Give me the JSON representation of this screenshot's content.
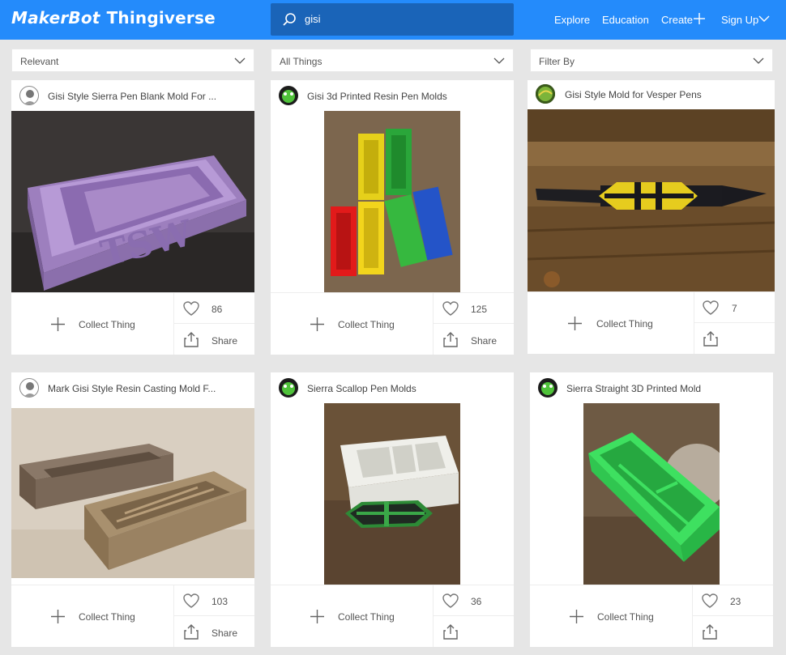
{
  "header": {
    "logo_maker": "MakerBot",
    "logo_product": "Thingiverse",
    "search_value": "gisi",
    "nav": {
      "explore": "Explore",
      "education": "Education",
      "create": "Create",
      "signup": "Sign Up"
    },
    "colors": {
      "bar": "#248bfb",
      "search_bg": "#1a64b8"
    }
  },
  "filters": {
    "sort": "Relevant",
    "category": "All Things",
    "filter_by": "Filter By"
  },
  "cards": [
    {
      "title": "Gisi Style Sierra Pen Blank Mold For ...",
      "likes": "86",
      "collect": "Collect Thing",
      "share": "Share",
      "avatar": "person-avatar-icon"
    },
    {
      "title": "Gisi 3d Printed Resin Pen Molds",
      "likes": "125",
      "collect": "Collect Thing",
      "share": "Share",
      "avatar": "frog-avatar-icon"
    },
    {
      "title": "Gisi Style Mold for Vesper Pens",
      "likes": "7",
      "collect": "Collect Thing",
      "share": "",
      "avatar": "green-avatar-icon"
    },
    {
      "title": "Mark Gisi Style Resin Casting Mold F...",
      "likes": "103",
      "collect": "Collect Thing",
      "share": "Share",
      "avatar": "person-avatar-icon"
    },
    {
      "title": "Sierra Scallop Pen Molds",
      "likes": "36",
      "collect": "Collect Thing",
      "share": "",
      "avatar": "frog-avatar-icon"
    },
    {
      "title": "Sierra Straight 3D Printed Mold",
      "likes": "23",
      "collect": "Collect Thing",
      "share": "",
      "avatar": "frog-avatar-icon"
    }
  ]
}
